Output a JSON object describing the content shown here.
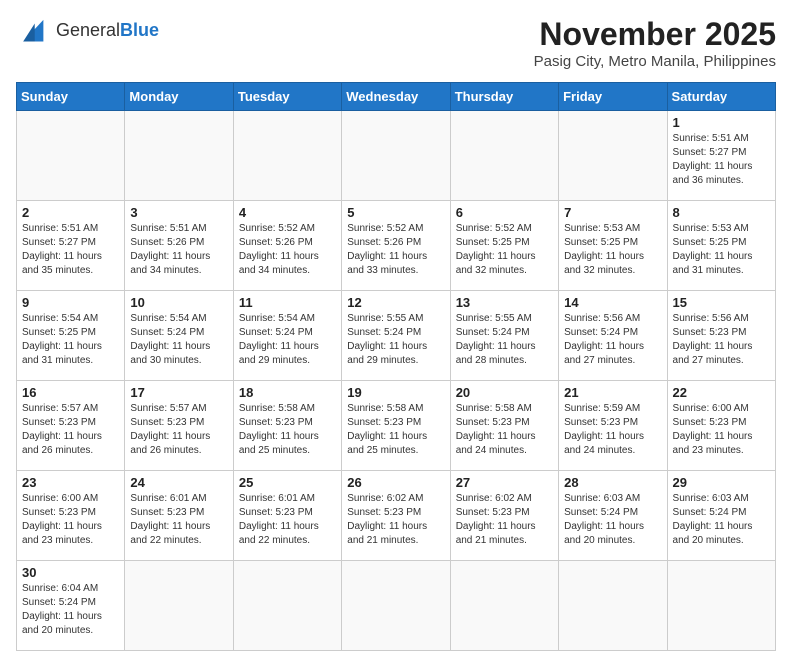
{
  "header": {
    "logo_general": "General",
    "logo_blue": "Blue",
    "month_title": "November 2025",
    "location": "Pasig City, Metro Manila, Philippines"
  },
  "weekdays": [
    "Sunday",
    "Monday",
    "Tuesday",
    "Wednesday",
    "Thursday",
    "Friday",
    "Saturday"
  ],
  "weeks": [
    [
      {
        "day": "",
        "info": ""
      },
      {
        "day": "",
        "info": ""
      },
      {
        "day": "",
        "info": ""
      },
      {
        "day": "",
        "info": ""
      },
      {
        "day": "",
        "info": ""
      },
      {
        "day": "",
        "info": ""
      },
      {
        "day": "1",
        "info": "Sunrise: 5:51 AM\nSunset: 5:27 PM\nDaylight: 11 hours\nand 36 minutes."
      }
    ],
    [
      {
        "day": "2",
        "info": "Sunrise: 5:51 AM\nSunset: 5:27 PM\nDaylight: 11 hours\nand 35 minutes."
      },
      {
        "day": "3",
        "info": "Sunrise: 5:51 AM\nSunset: 5:26 PM\nDaylight: 11 hours\nand 34 minutes."
      },
      {
        "day": "4",
        "info": "Sunrise: 5:52 AM\nSunset: 5:26 PM\nDaylight: 11 hours\nand 34 minutes."
      },
      {
        "day": "5",
        "info": "Sunrise: 5:52 AM\nSunset: 5:26 PM\nDaylight: 11 hours\nand 33 minutes."
      },
      {
        "day": "6",
        "info": "Sunrise: 5:52 AM\nSunset: 5:25 PM\nDaylight: 11 hours\nand 32 minutes."
      },
      {
        "day": "7",
        "info": "Sunrise: 5:53 AM\nSunset: 5:25 PM\nDaylight: 11 hours\nand 32 minutes."
      },
      {
        "day": "8",
        "info": "Sunrise: 5:53 AM\nSunset: 5:25 PM\nDaylight: 11 hours\nand 31 minutes."
      }
    ],
    [
      {
        "day": "9",
        "info": "Sunrise: 5:54 AM\nSunset: 5:25 PM\nDaylight: 11 hours\nand 31 minutes."
      },
      {
        "day": "10",
        "info": "Sunrise: 5:54 AM\nSunset: 5:24 PM\nDaylight: 11 hours\nand 30 minutes."
      },
      {
        "day": "11",
        "info": "Sunrise: 5:54 AM\nSunset: 5:24 PM\nDaylight: 11 hours\nand 29 minutes."
      },
      {
        "day": "12",
        "info": "Sunrise: 5:55 AM\nSunset: 5:24 PM\nDaylight: 11 hours\nand 29 minutes."
      },
      {
        "day": "13",
        "info": "Sunrise: 5:55 AM\nSunset: 5:24 PM\nDaylight: 11 hours\nand 28 minutes."
      },
      {
        "day": "14",
        "info": "Sunrise: 5:56 AM\nSunset: 5:24 PM\nDaylight: 11 hours\nand 27 minutes."
      },
      {
        "day": "15",
        "info": "Sunrise: 5:56 AM\nSunset: 5:23 PM\nDaylight: 11 hours\nand 27 minutes."
      }
    ],
    [
      {
        "day": "16",
        "info": "Sunrise: 5:57 AM\nSunset: 5:23 PM\nDaylight: 11 hours\nand 26 minutes."
      },
      {
        "day": "17",
        "info": "Sunrise: 5:57 AM\nSunset: 5:23 PM\nDaylight: 11 hours\nand 26 minutes."
      },
      {
        "day": "18",
        "info": "Sunrise: 5:58 AM\nSunset: 5:23 PM\nDaylight: 11 hours\nand 25 minutes."
      },
      {
        "day": "19",
        "info": "Sunrise: 5:58 AM\nSunset: 5:23 PM\nDaylight: 11 hours\nand 25 minutes."
      },
      {
        "day": "20",
        "info": "Sunrise: 5:58 AM\nSunset: 5:23 PM\nDaylight: 11 hours\nand 24 minutes."
      },
      {
        "day": "21",
        "info": "Sunrise: 5:59 AM\nSunset: 5:23 PM\nDaylight: 11 hours\nand 24 minutes."
      },
      {
        "day": "22",
        "info": "Sunrise: 6:00 AM\nSunset: 5:23 PM\nDaylight: 11 hours\nand 23 minutes."
      }
    ],
    [
      {
        "day": "23",
        "info": "Sunrise: 6:00 AM\nSunset: 5:23 PM\nDaylight: 11 hours\nand 23 minutes."
      },
      {
        "day": "24",
        "info": "Sunrise: 6:01 AM\nSunset: 5:23 PM\nDaylight: 11 hours\nand 22 minutes."
      },
      {
        "day": "25",
        "info": "Sunrise: 6:01 AM\nSunset: 5:23 PM\nDaylight: 11 hours\nand 22 minutes."
      },
      {
        "day": "26",
        "info": "Sunrise: 6:02 AM\nSunset: 5:23 PM\nDaylight: 11 hours\nand 21 minutes."
      },
      {
        "day": "27",
        "info": "Sunrise: 6:02 AM\nSunset: 5:23 PM\nDaylight: 11 hours\nand 21 minutes."
      },
      {
        "day": "28",
        "info": "Sunrise: 6:03 AM\nSunset: 5:24 PM\nDaylight: 11 hours\nand 20 minutes."
      },
      {
        "day": "29",
        "info": "Sunrise: 6:03 AM\nSunset: 5:24 PM\nDaylight: 11 hours\nand 20 minutes."
      }
    ],
    [
      {
        "day": "30",
        "info": "Sunrise: 6:04 AM\nSunset: 5:24 PM\nDaylight: 11 hours\nand 20 minutes."
      },
      {
        "day": "",
        "info": ""
      },
      {
        "day": "",
        "info": ""
      },
      {
        "day": "",
        "info": ""
      },
      {
        "day": "",
        "info": ""
      },
      {
        "day": "",
        "info": ""
      },
      {
        "day": "",
        "info": ""
      }
    ]
  ]
}
